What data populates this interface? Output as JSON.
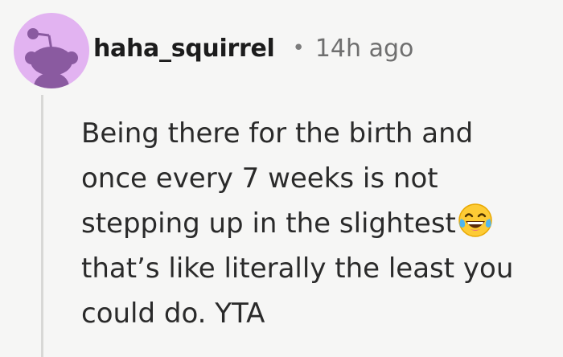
{
  "comment": {
    "author": "haha_squirrel",
    "separator": "•",
    "timestamp": "14h ago",
    "body_lines": [
      "Being there for the birth and",
      "once every 7 weeks is not",
      "stepping up in the slightest",
      "that’s like literally the least you",
      "could do. YTA"
    ],
    "emoji": "face-with-tears-of-joy-icon"
  },
  "colors": {
    "background": "#f6f6f5",
    "avatar_bg": "#e2b3f1",
    "avatar_figure": "#8a5aa0",
    "thread_line": "#d8d8d6",
    "text": "#2a2a2a"
  }
}
